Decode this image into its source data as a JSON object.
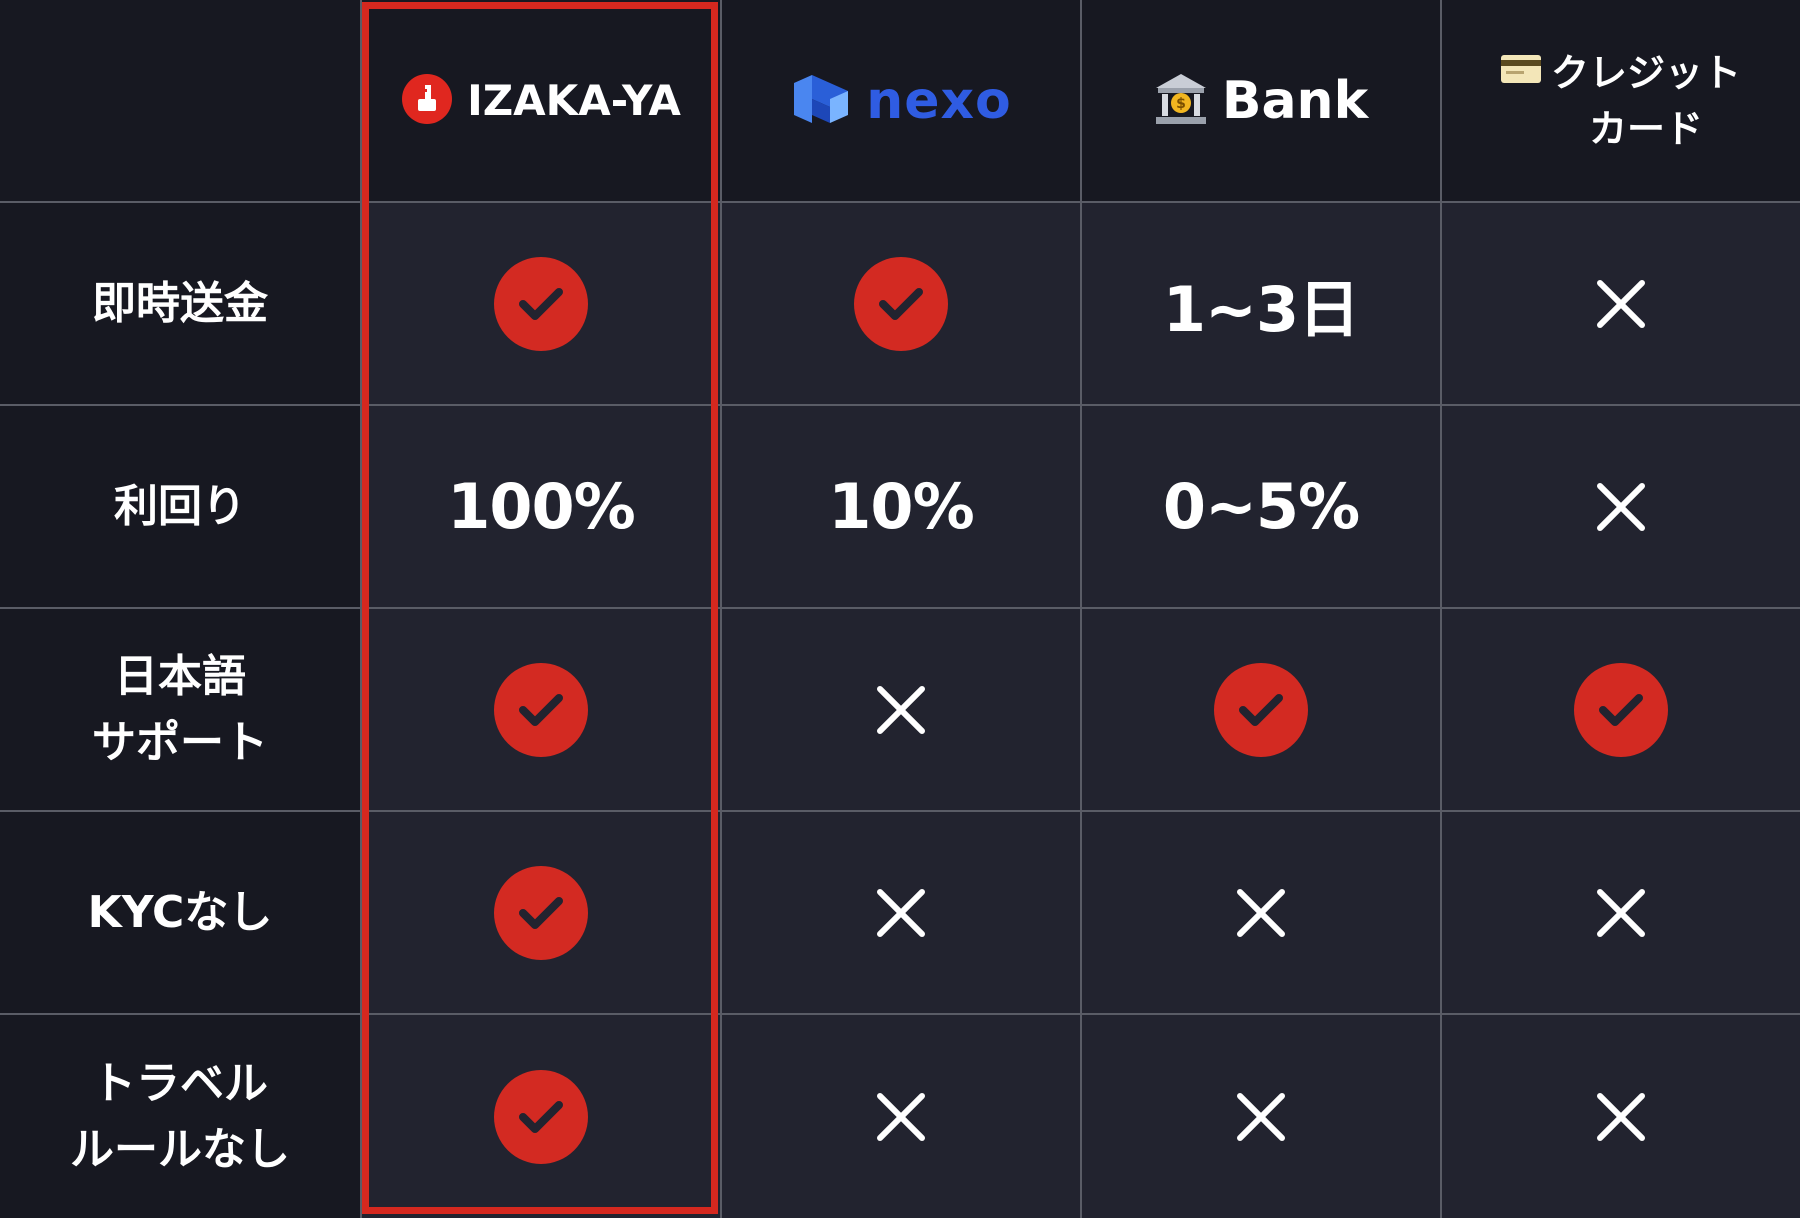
{
  "columns": [
    {
      "key": "izakaya",
      "label": "IZAKA-YA"
    },
    {
      "key": "nexo",
      "label": "nexo"
    },
    {
      "key": "bank",
      "label": "Bank"
    },
    {
      "key": "card",
      "label": "クレジット\nカード"
    }
  ],
  "rows": [
    {
      "label": "即時送金",
      "cells": [
        {
          "type": "check"
        },
        {
          "type": "check"
        },
        {
          "type": "text",
          "value": "1~3日"
        },
        {
          "type": "cross"
        }
      ]
    },
    {
      "label": "利回り",
      "cells": [
        {
          "type": "text",
          "value": "100%"
        },
        {
          "type": "text",
          "value": "10%"
        },
        {
          "type": "text",
          "value": "0~5%"
        },
        {
          "type": "cross"
        }
      ]
    },
    {
      "label": "日本語\nサポート",
      "cells": [
        {
          "type": "check"
        },
        {
          "type": "cross"
        },
        {
          "type": "check"
        },
        {
          "type": "check"
        }
      ]
    },
    {
      "label": "KYCなし",
      "cells": [
        {
          "type": "check"
        },
        {
          "type": "cross"
        },
        {
          "type": "cross"
        },
        {
          "type": "cross"
        }
      ]
    },
    {
      "label": "トラベル\nルールなし",
      "cells": [
        {
          "type": "check"
        },
        {
          "type": "cross"
        },
        {
          "type": "cross"
        },
        {
          "type": "cross"
        }
      ]
    }
  ],
  "highlighted_column": "izakaya",
  "colors": {
    "accent_red": "#d32a22",
    "nexo_blue": "#2f5ce2",
    "background": "#1b1c26"
  },
  "icons": {
    "izakaya": "izakaya-logo-icon",
    "nexo": "nexo-logo-icon",
    "bank": "bank-building-icon",
    "card": "credit-card-icon",
    "check": "check-circle-icon",
    "cross": "cross-icon"
  }
}
